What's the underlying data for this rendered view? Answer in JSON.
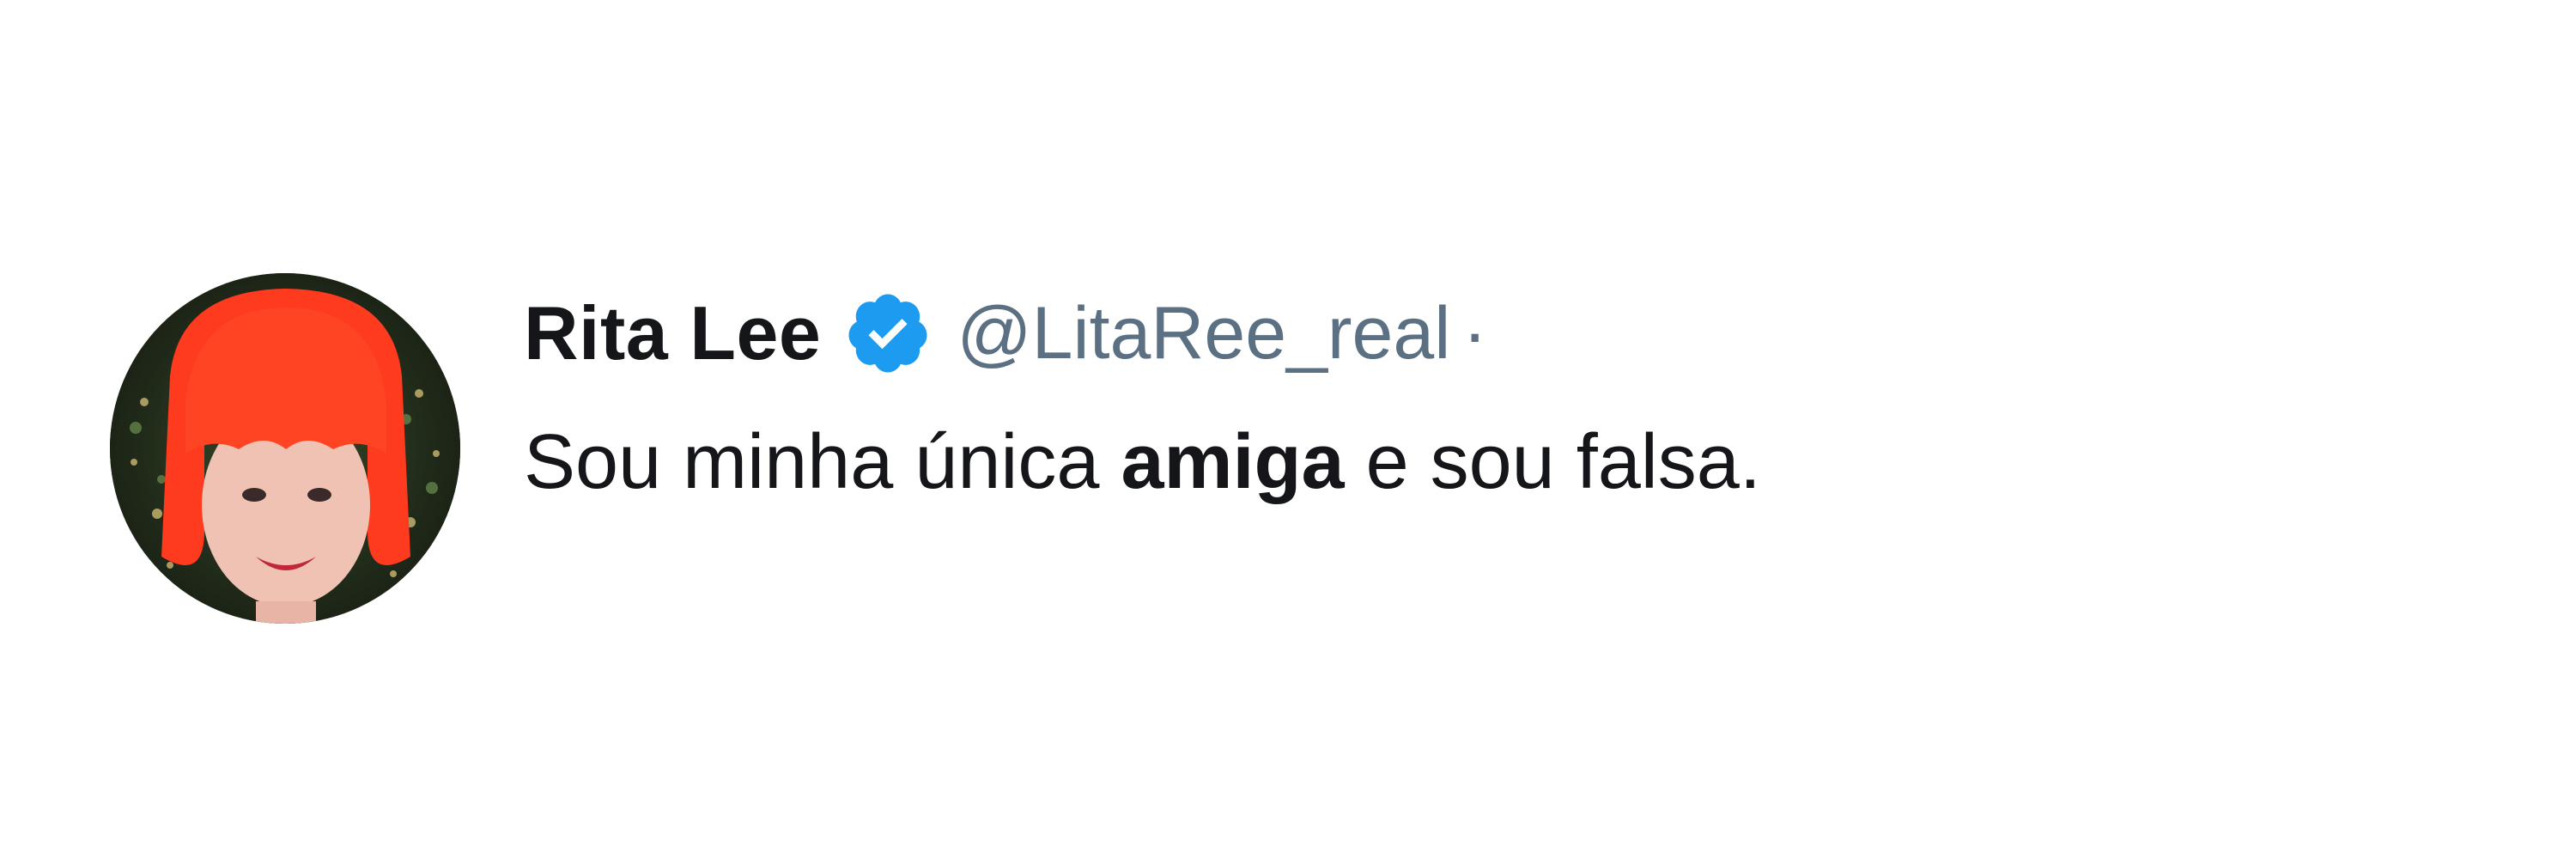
{
  "tweet": {
    "author": {
      "display_name": "Rita Lee",
      "verified": true,
      "handle": "@LitaRee_real",
      "separator": "·"
    },
    "text": {
      "before": "Sou minha única ",
      "emphasis": "amiga",
      "after": " e sou falsa."
    },
    "icons": {
      "verified_badge": "verified-badge-icon",
      "avatar": "profile-photo-red-hair"
    },
    "colors": {
      "verified_blue": "#1d9bf0",
      "handle_gray": "#5b7083",
      "text": "#141619",
      "hair_red": "#ff3b1f"
    }
  }
}
